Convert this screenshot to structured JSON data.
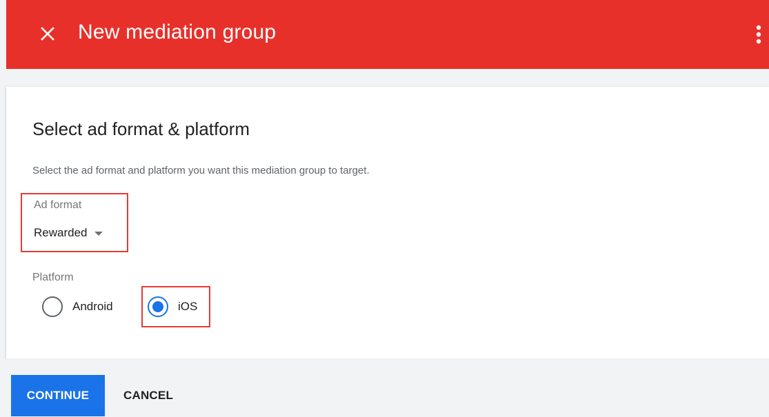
{
  "header": {
    "title": "New mediation group",
    "close_icon": "close-icon",
    "more_icon": "more-vert-icon",
    "color": "#e8302a"
  },
  "card": {
    "title": "Select ad format & platform",
    "description": "Select the ad format and platform you want this mediation group to target."
  },
  "ad_format": {
    "label": "Ad format",
    "selected": "Rewarded"
  },
  "platform": {
    "label": "Platform",
    "options": [
      {
        "label": "Android",
        "checked": false
      },
      {
        "label": "iOS",
        "checked": true
      }
    ]
  },
  "footer": {
    "continue_label": "CONTINUE",
    "cancel_label": "CANCEL"
  },
  "colors": {
    "accent": "#1a73e8",
    "highlight": "#e53935"
  }
}
